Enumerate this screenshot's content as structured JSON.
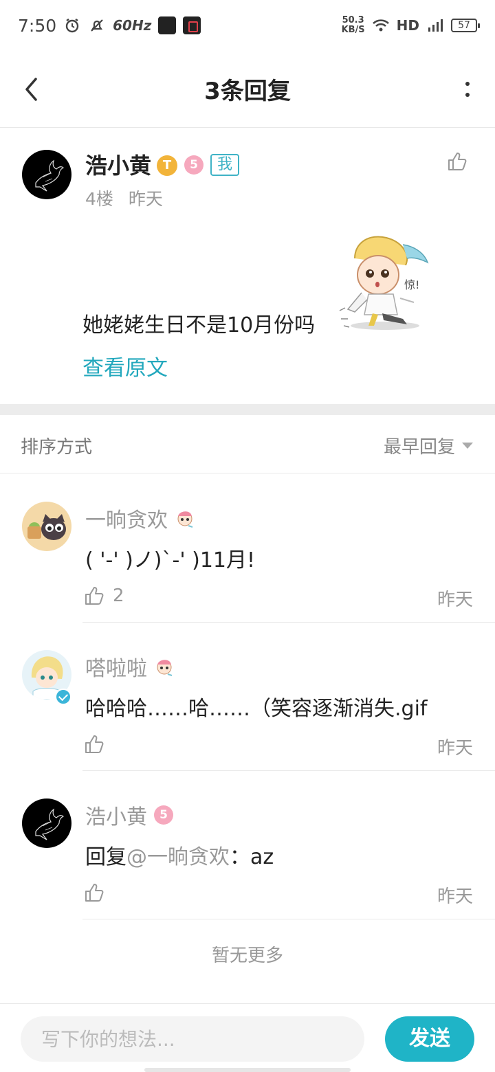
{
  "status_bar": {
    "time": "7:50",
    "refresh_rate": "60Hz",
    "net_speed_value": "50.3",
    "net_speed_unit": "KB/S",
    "hd": "HD",
    "battery": "57"
  },
  "header": {
    "title": "3条回复"
  },
  "main_post": {
    "username": "浩小黄",
    "badge_t": "T",
    "level": "5",
    "me_tag": "我",
    "floor": "4楼",
    "time": "昨天",
    "content": "她姥姥生日不是10月份吗",
    "view_original": "查看原文"
  },
  "sort": {
    "label": "排序方式",
    "value": "最早回复"
  },
  "replies": [
    {
      "username": "一晌贪欢",
      "text": "( '-' )ノ)`-' )11月!",
      "likes": "2",
      "time": "昨天"
    },
    {
      "username": "嗒啦啦",
      "text": "哈哈哈……哈……（笑容逐渐消失.gif",
      "likes": "",
      "time": "昨天"
    },
    {
      "username": "浩小黄",
      "level": "5",
      "text_prefix": "回复",
      "mention": "@一晌贪欢",
      "text_suffix": "：az",
      "likes": "",
      "time": "昨天"
    }
  ],
  "no_more": "暂无更多",
  "input": {
    "placeholder": "写下你的想法...",
    "send_label": "发送"
  },
  "colors": {
    "accent": "#1fb4c7",
    "link": "#23a8bd"
  }
}
